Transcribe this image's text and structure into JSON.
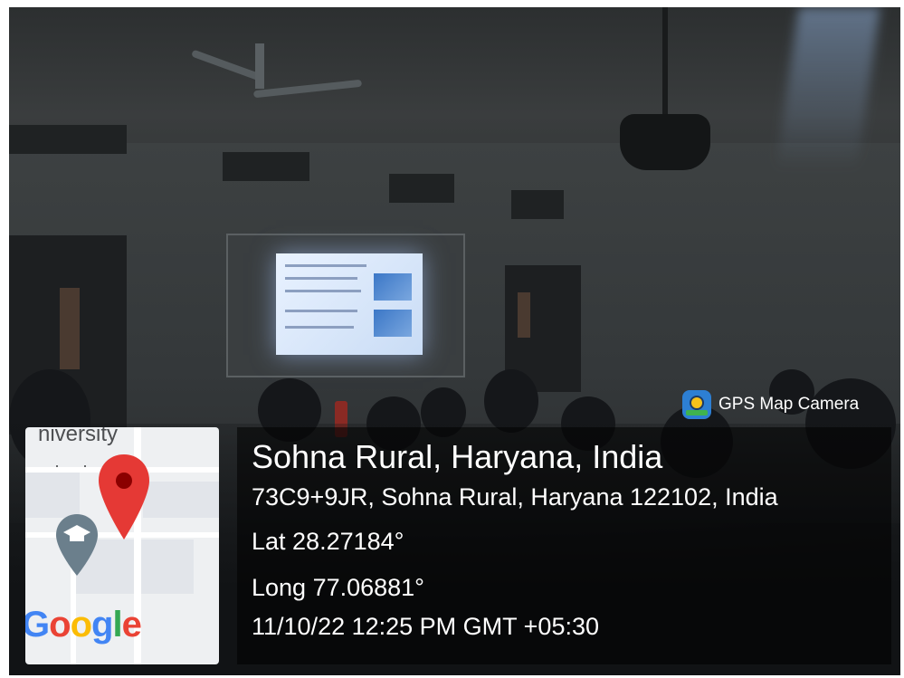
{
  "overlay": {
    "app_badge": "GPS Map Camera",
    "location_title": "Sohna Rural, Haryana, India",
    "address": "73C9+9JR, Sohna Rural, Haryana 122102, India",
    "latitude": "Lat 28.27184°",
    "longitude": "Long 77.06881°",
    "datetime": "11/10/22 12:25 PM GMT +05:30"
  },
  "map": {
    "label_partial": "niversity",
    "dots": "· ·",
    "provider": "Google",
    "pin_color": "#e53935",
    "pin_inner_color": "#8b0000",
    "school_pin_color": "#6b7f8c",
    "google_colors": [
      "#4285F4",
      "#EA4335",
      "#FBBC05",
      "#4285F4",
      "#34A853",
      "#EA4335"
    ]
  },
  "icons": {
    "badge": "gps-map-camera-icon",
    "pin": "map-pin-icon",
    "school": "graduation-cap-icon"
  }
}
